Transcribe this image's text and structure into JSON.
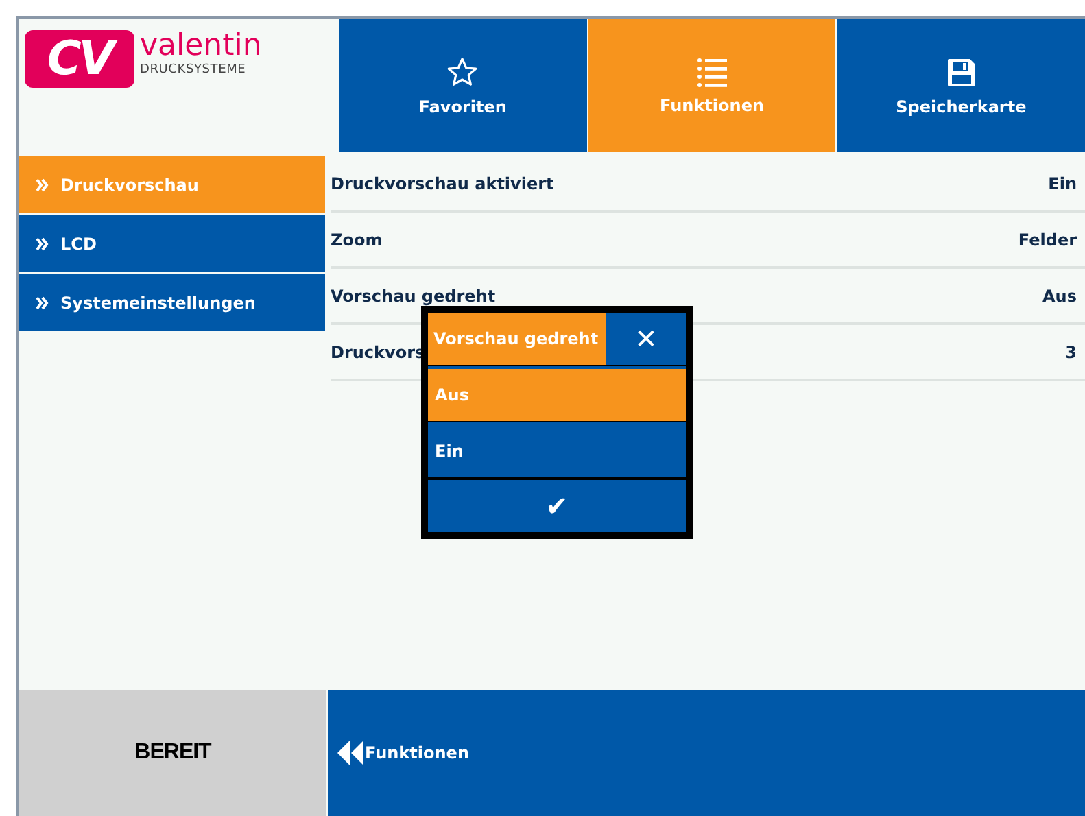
{
  "logo": {
    "mark": "CV",
    "name": "valentin",
    "subtitle": "DRUCKSYSTEME"
  },
  "tabs": [
    {
      "label": "Favoriten",
      "kind": "star",
      "selected": false
    },
    {
      "label": "Funktionen",
      "kind": "list",
      "selected": true
    },
    {
      "label": "Speicherkarte",
      "kind": "floppy",
      "selected": false
    }
  ],
  "sidebar": {
    "items": [
      {
        "label": "Druckvorschau",
        "selected": true
      },
      {
        "label": "LCD",
        "selected": false
      },
      {
        "label": "Systemeinstellungen",
        "selected": false
      }
    ]
  },
  "settings": [
    {
      "name": "Druckvorschau aktiviert",
      "value": "Ein"
    },
    {
      "name": "Zoom",
      "value": "Felder"
    },
    {
      "name": "Vorschau gedreht",
      "value": "Aus"
    },
    {
      "name": "Druckvors",
      "value": "3"
    }
  ],
  "dialog": {
    "title": "Vorschau gedreht",
    "close": "✕",
    "options": [
      {
        "label": "Aus",
        "selected": true
      },
      {
        "label": "Ein",
        "selected": false
      }
    ],
    "confirm": "✔"
  },
  "status_bar": {
    "status": "BEREIT",
    "back": "Funktionen"
  }
}
